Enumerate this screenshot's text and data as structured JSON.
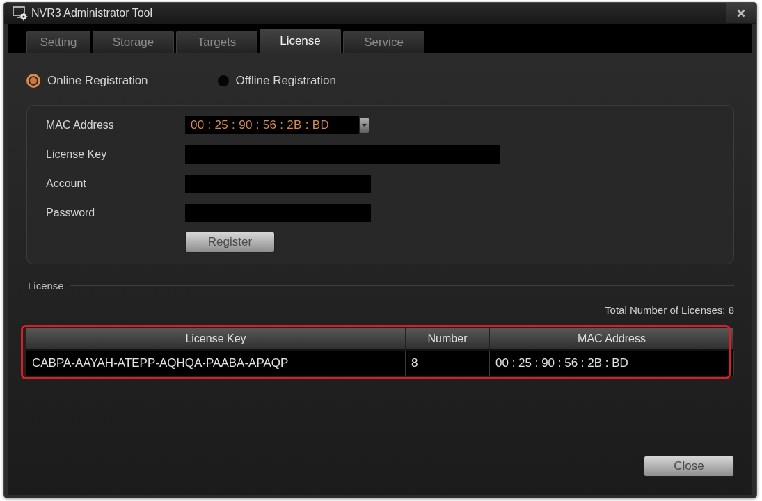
{
  "window": {
    "title": "NVR3 Administrator Tool"
  },
  "tabs": [
    {
      "label": "Setting",
      "selected": false
    },
    {
      "label": "Storage",
      "selected": false
    },
    {
      "label": "Targets",
      "selected": false
    },
    {
      "label": "License",
      "selected": true
    },
    {
      "label": "Service",
      "selected": false
    }
  ],
  "registration_modes": [
    {
      "label": "Online Registration",
      "selected": true
    },
    {
      "label": "Offline Registration",
      "selected": false
    }
  ],
  "registration_form": {
    "fields": [
      {
        "label": "MAC Address",
        "kind": "dropdown",
        "value": "00 : 25 : 90 : 56 : 2B : BD"
      },
      {
        "label": "License Key",
        "kind": "text"
      },
      {
        "label": "Account",
        "kind": "text"
      },
      {
        "label": "Password",
        "kind": "text"
      }
    ],
    "button": "Register"
  },
  "license": {
    "title": "License",
    "total": "Total Number of Licenses: 8",
    "table": {
      "highlighted": true,
      "columns": [
        "License Key",
        "Number",
        "MAC Address"
      ],
      "rows": [
        [
          "CABPA-AAYAH-ATEPP-AQHQA-PAABA-APAQP",
          "8",
          "00 : 25 : 90 : 56 : 2B : BD"
        ]
      ]
    }
  },
  "buttons": {
    "close": "Close"
  }
}
